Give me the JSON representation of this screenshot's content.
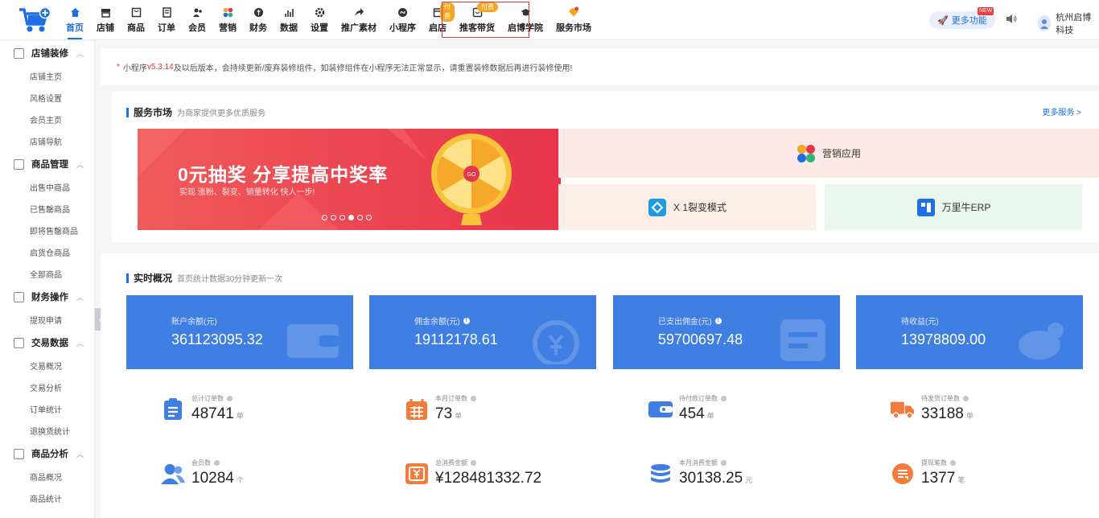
{
  "nav": {
    "items": [
      {
        "label": "首页"
      },
      {
        "label": "店铺"
      },
      {
        "label": "商品"
      },
      {
        "label": "订单"
      },
      {
        "label": "会员"
      },
      {
        "label": "营销"
      },
      {
        "label": "财务"
      },
      {
        "label": "数据"
      },
      {
        "label": "设置"
      },
      {
        "label": "推广素材"
      },
      {
        "label": "小程序"
      },
      {
        "label": "启店",
        "badge": "付费"
      },
      {
        "label": "推客带货",
        "badge": "付费"
      },
      {
        "label": "启博学院"
      },
      {
        "label": "服务市场"
      }
    ],
    "more_functions": "更多功能",
    "new_tag": "NEW",
    "user_name": "杭州启博科技"
  },
  "sidebar": {
    "groups": [
      {
        "title": "店铺装修",
        "items": [
          "店铺主页",
          "风格设置",
          "会员主页",
          "店铺导航"
        ]
      },
      {
        "title": "商品管理",
        "items": [
          "出售中商品",
          "已售罄商品",
          "即将售罄商品",
          "启货仓商品",
          "全部商品"
        ]
      },
      {
        "title": "财务操作",
        "items": [
          "提现申请"
        ]
      },
      {
        "title": "交易数据",
        "items": [
          "交易概况",
          "交易分析",
          "订单统计",
          "退换货统计"
        ]
      },
      {
        "title": "商品分析",
        "items": [
          "商品概况",
          "商品统计"
        ]
      }
    ]
  },
  "notice": {
    "star": "*",
    "prefix": "小程序",
    "version": "v5.3.14",
    "text": "及以后版本，会持续更新/废弃装修组件，如装修组件在小程序无法正常显示，请重置装修数据后再进行装修使用!"
  },
  "service": {
    "title": "服务市场",
    "subtitle": "为商家提供更多优质服务",
    "more": "更多服务 >",
    "banner_title": "0元抽奖  分享提高中奖率",
    "banner_sub": "实现 涨粉、裂变、销量转化 快人一步!",
    "wheel_center": "GO",
    "promo_marketing": "营销应用",
    "promo_fission": "X 1裂变模式",
    "promo_erp": "万里牛ERP"
  },
  "overview": {
    "title": "实时概况",
    "subtitle": "首页统计数据30分钟更新一次",
    "stats": [
      {
        "label": "账户余额(元)",
        "value": "361123095.32"
      },
      {
        "label": "佣金余额(元)",
        "value": "19112178.61"
      },
      {
        "label": "已支出佣金(元)",
        "value": "59700697.48"
      },
      {
        "label": "待收益(元)",
        "value": "13978809.00"
      }
    ],
    "metrics": [
      {
        "label": "总计订单数",
        "value": "48741",
        "unit": "单",
        "color": "#3f7ee2"
      },
      {
        "label": "本月订单数",
        "value": "73",
        "unit": "单",
        "color": "#f37b3c"
      },
      {
        "label": "待付款订单数",
        "value": "454",
        "unit": "单",
        "color": "#3f7ee2"
      },
      {
        "label": "待发货订单数",
        "value": "33188",
        "unit": "单",
        "color": "#f37b3c"
      },
      {
        "label": "会员数",
        "value": "10284",
        "unit": "个",
        "color": "#3f7ee2"
      },
      {
        "label": "总消费金额",
        "value": "¥128481332.72",
        "unit": "",
        "color": "#f37b3c"
      },
      {
        "label": "本月消费金额",
        "value": "30138.25",
        "unit": "元",
        "color": "#3f7ee2"
      },
      {
        "label": "提现笔数",
        "value": "1377",
        "unit": "笔",
        "color": "#f37b3c"
      }
    ]
  }
}
